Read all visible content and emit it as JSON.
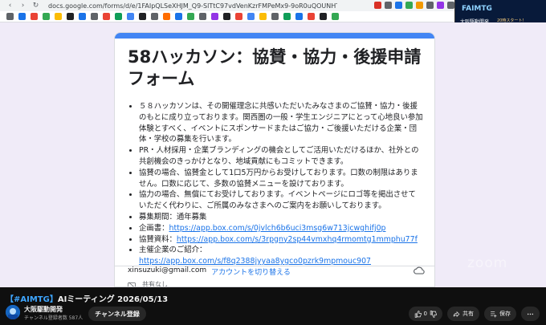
{
  "browser": {
    "url": "docs.google.com/forms/d/e/1FAIpQLSeXHJM_Q9-SlTtC97vdVenKzrFMPeMx9-9oR0uQOUNHTFrJRA/viewform"
  },
  "overlay": {
    "banner": "FAIMTG",
    "title": "大阪駆動開発",
    "subtitle": "20時スタート！"
  },
  "form": {
    "title": "58ハッカソン：協賛・協力・後援申請フォーム",
    "items": [
      "５８ハッカソンは、その開催理念に共感いただいたみなさまのご協賛・協力・後援のもとに成り立っております。関西圏の一般・学生エンジニアにとって心地良い参加体験とすべく、イベントにスポンサードまたはご協力・ご後援いただける企業・団体・学校の募集を行います。",
      "PR・人材採用・企業ブランディングの機会としてご活用いただけるほか、社外との共創機会のきっかけとなり、地域貢献にもコミットできます。",
      "協賛の場合、協賛金として1口5万円からお受けしております。口数の制限はありません。口数に応じて、多数の協賛メニューを設けております。",
      "協力の場合、無償にてお受けしております。イベントページにロゴ等を掲出させていただく代わりに、ご所属のみなさまへのご案内をお願いしております。",
      "募集期間：通年募集"
    ],
    "links": [
      {
        "label": "企画書：",
        "url": "https://app.box.com/s/0jvlch6b6uci3msg6w713jcwghifj0p"
      },
      {
        "label": "協賛資料：",
        "url": "https://app.box.com/s/3rpgny2sp44vmxhq4rmomtg1mmphu77f"
      },
      {
        "label": "主催企業のご紹介：",
        "url": "https://app.box.com/s/f8q2388jyyaa8ygco0pzrk9mpmouc907"
      }
    ],
    "account_email": "xinsuzuki@gmail.com",
    "switch_account": "アカウントを切り替える",
    "shared_note": "共有なし"
  },
  "watermark": "zoom",
  "video": {
    "title_tag": "【#AIMTG】",
    "title_rest": "AIミーティング 2026/05/13",
    "channel_name": "大阪駆動開発",
    "channel_subs": "チャンネル登録者数 587人",
    "subscribe_label": "チャンネル登録",
    "like_count": "0",
    "share_label": "共有",
    "save_label": "保存"
  },
  "colors": {
    "form_accent": "#4285f4",
    "form_bg": "#f0ebf8",
    "link": "#1a73e8",
    "youtube_bg": "#0f0f0f"
  }
}
